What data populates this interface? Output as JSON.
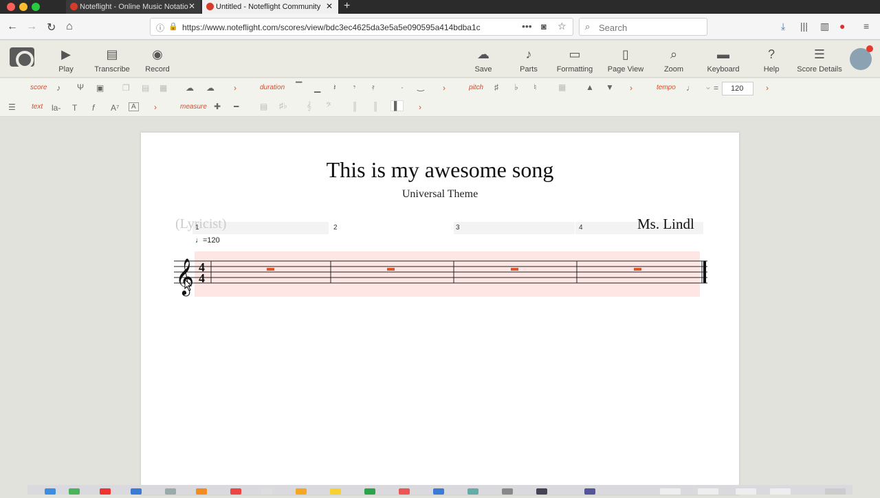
{
  "browser": {
    "tabs": [
      {
        "title": "Noteflight - Online Music Notatio",
        "active": false
      },
      {
        "title": "Untitled - Noteflight Community",
        "active": true
      }
    ],
    "url": "https://www.noteflight.com/scores/view/bdc3ec4625da3e5a5e090595a414bdba1c",
    "search_placeholder": "Search"
  },
  "toolbar": {
    "play": "Play",
    "transcribe": "Transcribe",
    "record": "Record",
    "save": "Save",
    "parts": "Parts",
    "formatting": "Formatting",
    "page_view": "Page View",
    "zoom": "Zoom",
    "keyboard": "Keyboard",
    "help": "Help",
    "score_details": "Score Details"
  },
  "palette": {
    "score": "score",
    "duration": "duration",
    "pitch": "pitch",
    "tempo": "tempo",
    "tempo_eq": "=",
    "tempo_value": "120",
    "text": "text",
    "measure": "measure",
    "text_buttons": {
      "lyric": "la-",
      "text": "T",
      "dynamic": "f",
      "chord": "A⁷",
      "box": "A"
    },
    "accidentals": {
      "sharp": "♯",
      "flat": "♭",
      "natural": "♮"
    }
  },
  "score": {
    "title": "This is my awesome song",
    "subtitle": "Universal Theme",
    "lyricist": "(Lyricist)",
    "composer": "Ms. Lindl",
    "tempo_mark": "=120",
    "measures": [
      "1",
      "2",
      "3",
      "4"
    ],
    "time_signature": "4/4"
  },
  "colors": {
    "accent": "#d94a2b",
    "highlight": "#fde6e3"
  }
}
